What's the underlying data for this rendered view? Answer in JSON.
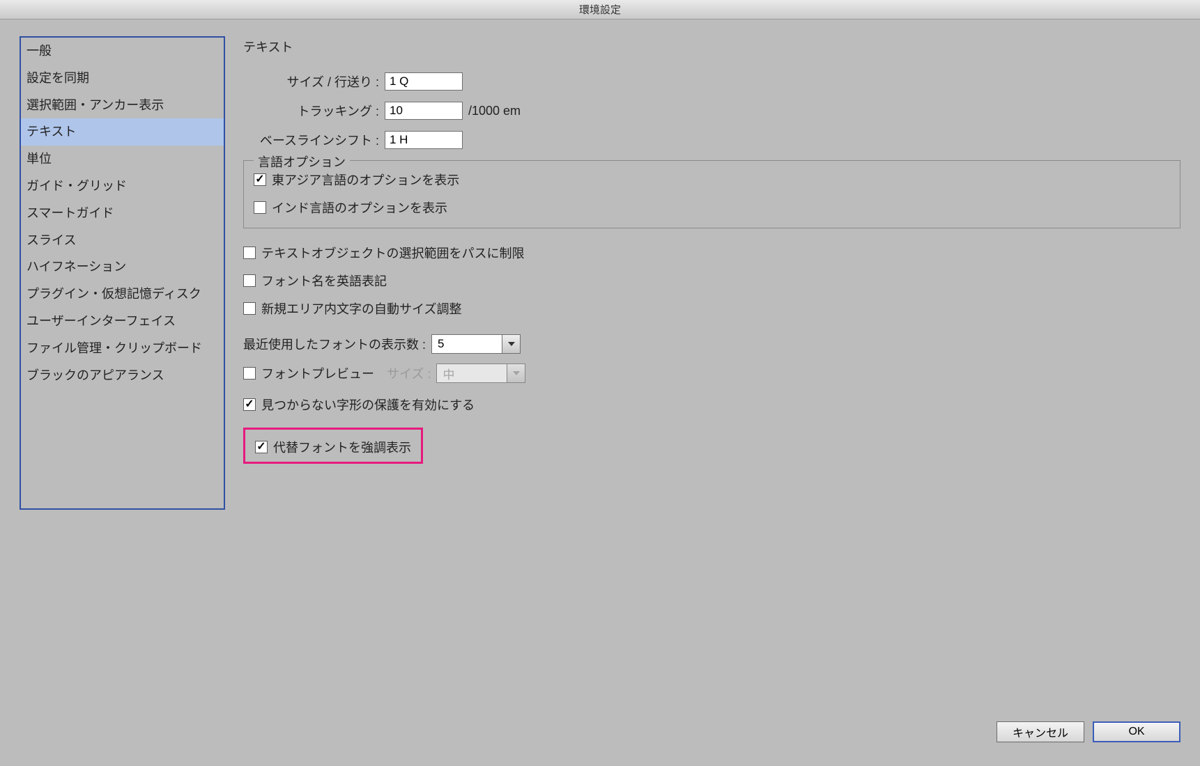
{
  "title": "環境設定",
  "sidebar": {
    "items": [
      {
        "label": "一般"
      },
      {
        "label": "設定を同期"
      },
      {
        "label": "選択範囲・アンカー表示"
      },
      {
        "label": "テキスト"
      },
      {
        "label": "単位"
      },
      {
        "label": "ガイド・グリッド"
      },
      {
        "label": "スマートガイド"
      },
      {
        "label": "スライス"
      },
      {
        "label": "ハイフネーション"
      },
      {
        "label": "プラグイン・仮想記憶ディスク"
      },
      {
        "label": "ユーザーインターフェイス"
      },
      {
        "label": "ファイル管理・クリップボード"
      },
      {
        "label": "ブラックのアピアランス"
      }
    ],
    "selectedIndex": 3
  },
  "main": {
    "sectionTitle": "テキスト",
    "size": {
      "label": "サイズ / 行送り :",
      "value": "1 Q"
    },
    "tracking": {
      "label": "トラッキング :",
      "value": "10",
      "unit": "/1000 em"
    },
    "baseline": {
      "label": "ベースラインシフト :",
      "value": "1 H"
    },
    "langOptions": {
      "legend": "言語オプション",
      "eastAsian": {
        "label": "東アジア言語のオプションを表示",
        "checked": true
      },
      "indic": {
        "label": "インド言語のオプションを表示",
        "checked": false
      }
    },
    "limitPath": {
      "label": "テキストオブジェクトの選択範囲をパスに制限",
      "checked": false
    },
    "englishFontNames": {
      "label": "フォント名を英語表記",
      "checked": false
    },
    "autoSize": {
      "label": "新規エリア内文字の自動サイズ調整",
      "checked": false
    },
    "recentFonts": {
      "label": "最近使用したフォントの表示数 :",
      "value": "5"
    },
    "fontPreview": {
      "label": "フォントプレビュー",
      "checked": false,
      "sizeLabel": "サイズ :",
      "sizeValue": "中"
    },
    "missingGlyph": {
      "label": "見つからない字形の保護を有効にする",
      "checked": true
    },
    "highlightSubstitute": {
      "label": "代替フォントを強調表示",
      "checked": true
    }
  },
  "buttons": {
    "cancel": "キャンセル",
    "ok": "OK"
  }
}
